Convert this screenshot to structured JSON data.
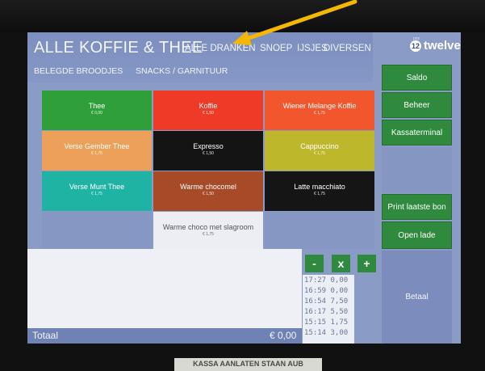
{
  "categories": {
    "active": "ALLE KOFFIE & THEE",
    "tabs": [
      "ALLE DRANKEN",
      "SNOEP",
      "IJSJES",
      "DIVERSEN",
      "BELEGDE BROODJES",
      "SNACKS / GARNITUUR"
    ]
  },
  "logo": {
    "text": "twelve",
    "badge": "12",
    "sub": "pos"
  },
  "products": [
    {
      "name": "Thee",
      "price": "€ 0,00",
      "color": "#2fa039"
    },
    {
      "name": "Koffie",
      "price": "€ 1,50",
      "color": "#ee3a26"
    },
    {
      "name": "Wiener Melange Koffie",
      "price": "€ 1,75",
      "color": "#f1562c"
    },
    {
      "name": "Verse Gember Thee",
      "price": "€ 1,75",
      "color": "#eda05a"
    },
    {
      "name": "Expresso",
      "price": "€ 1,50",
      "color": "#141414"
    },
    {
      "name": "Cappuccino",
      "price": "€ 1,75",
      "color": "#bdb72c"
    },
    {
      "name": "Verse Munt Thee",
      "price": "€ 1,75",
      "color": "#1fb3a3"
    },
    {
      "name": "Warme chocomel",
      "price": "€ 1,50",
      "color": "#a74a28"
    },
    {
      "name": "Latte macchiato",
      "price": "€ 1,75",
      "color": "#151515"
    },
    {
      "name": "Warme choco met slagroom",
      "price": "€ 1,75",
      "color": "#eceef3"
    }
  ],
  "sidebar": {
    "saldo": "Saldo",
    "beheer": "Beheer",
    "kassaterminal": "Kassaterminal",
    "print_laatste_bon": "Print laatste bon",
    "open_lade": "Open lade",
    "betaal": "Betaal"
  },
  "order": {
    "total_label": "Totaal",
    "total_value": "€ 0,00",
    "minus": "-",
    "remove": "x",
    "plus": "+"
  },
  "history": [
    {
      "time": "17:27",
      "amount": "0,00"
    },
    {
      "time": "16:59",
      "amount": "0,00"
    },
    {
      "time": "16:54",
      "amount": "7,50"
    },
    {
      "time": "16:17",
      "amount": "5,50"
    },
    {
      "time": "15:15",
      "amount": "1,75"
    },
    {
      "time": "15:14",
      "amount": "3,00"
    }
  ],
  "sticker": "KASSA AANLATEN STAAN AUB",
  "colors": {
    "screen_bg": "#8a9bc6",
    "button_green": "#2f8a3d",
    "annotation_arrow": "#f5b800"
  }
}
